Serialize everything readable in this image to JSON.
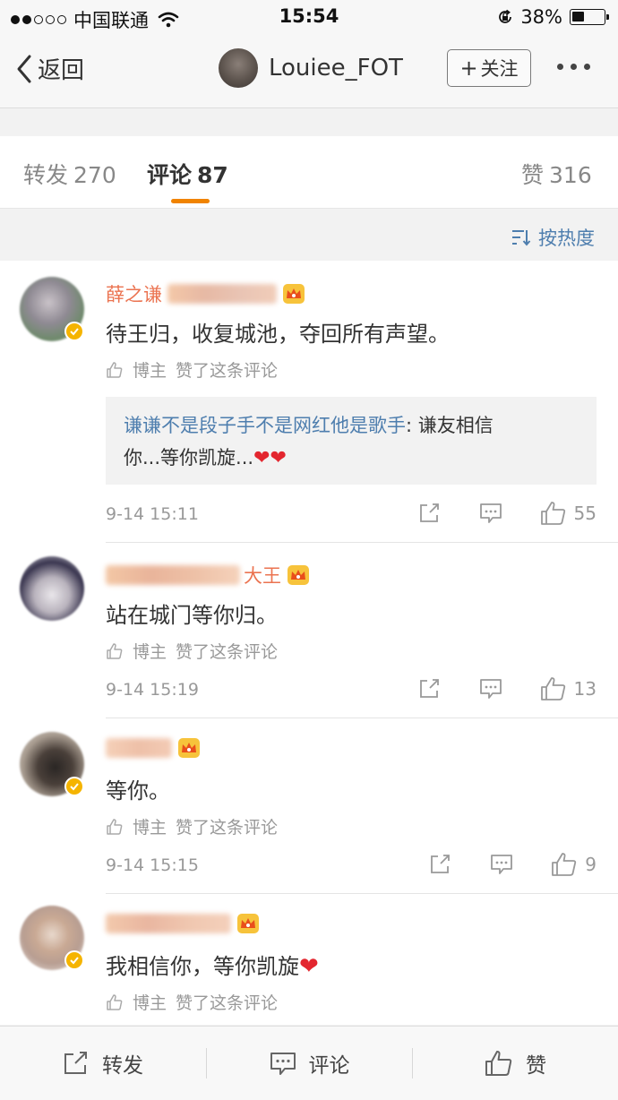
{
  "status_bar": {
    "carrier": "中国联通",
    "time": "15:54",
    "battery_percent": "38%",
    "battery_level": 0.38,
    "signal_bars_filled": 2
  },
  "nav": {
    "back_label": "返回",
    "profile_name": "Louiee_FOT",
    "follow_label": "关注"
  },
  "tabs": [
    {
      "label": "转发",
      "count": "270"
    },
    {
      "label": "评论",
      "count": "87"
    },
    {
      "label": "赞",
      "count": "316"
    }
  ],
  "sort": {
    "label": "按热度"
  },
  "comments": [
    {
      "username": "薛之谦",
      "text": "待王归，收复城池，夺回所有声望。",
      "liked_by": "博主",
      "liked_text": "赞了这条评论",
      "reply": {
        "user": "谦谦不是段子手不是网红他是歌手",
        "sep": ":",
        "text_line1": " 谦友相信",
        "text_line2": "你...等你凯旋..."
      },
      "time": "9-14 15:11",
      "likes": "55"
    },
    {
      "username": "大王",
      "text": "站在城门等你归。",
      "liked_by": "博主",
      "liked_text": "赞了这条评论",
      "time": "9-14 15:19",
      "likes": "13"
    },
    {
      "username": "",
      "text": "等你。",
      "liked_by": "博主",
      "liked_text": "赞了这条评论",
      "time": "9-14 15:15",
      "likes": "9"
    },
    {
      "username": "",
      "text": "我相信你，等你凯旋",
      "liked_by": "博主",
      "liked_text": "赞了这条评论"
    }
  ],
  "toolbar": {
    "repost_label": "转发",
    "comment_label": "评论",
    "like_label": "赞"
  },
  "colors": {
    "accent_orange": "#f08300",
    "link_blue": "#4e7eae",
    "username_orange": "#eb7350",
    "heart_red": "#e3262f",
    "verified_gold": "#f5b400"
  },
  "icons": {
    "signal": "signal-dots-icon",
    "wifi": "wifi-icon",
    "rotation_lock": "rotation-lock-icon",
    "battery": "battery-icon",
    "back": "chevron-left-icon",
    "more": "more-dots-icon",
    "sort": "sort-icon",
    "thumb": "thumbs-up-icon",
    "share": "share-icon",
    "comment": "comment-icon",
    "crown": "crown-icon",
    "verified": "verified-badge-icon",
    "heart": "heart-icon"
  }
}
